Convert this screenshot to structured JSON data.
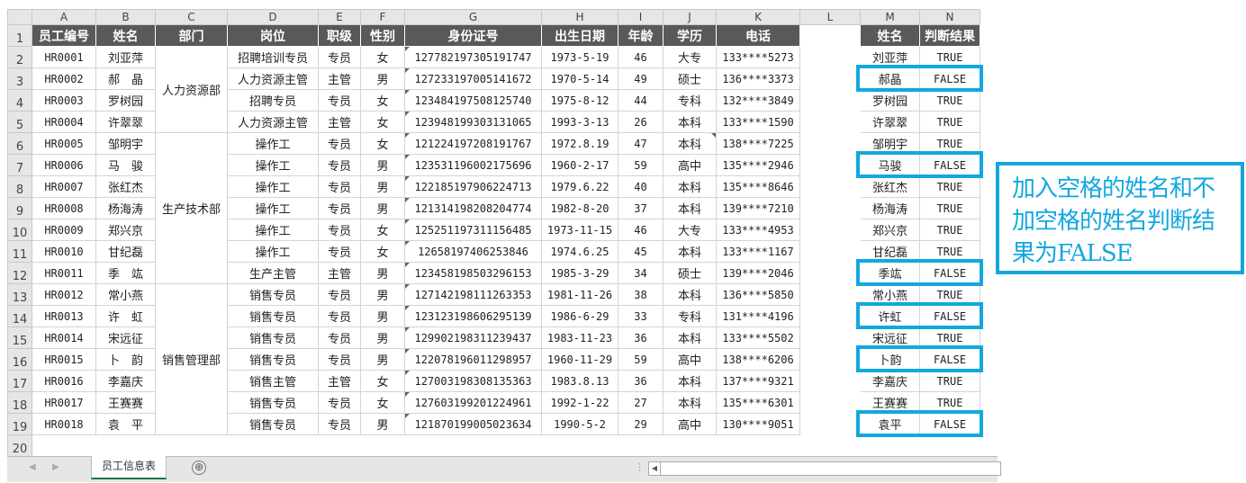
{
  "columns": [
    "A",
    "B",
    "C",
    "D",
    "E",
    "F",
    "G",
    "H",
    "I",
    "J",
    "K",
    "L",
    "M",
    "N"
  ],
  "headers": [
    "员工编号",
    "姓名",
    "部门",
    "岗位",
    "职级",
    "性别",
    "身份证号",
    "出生日期",
    "年龄",
    "学历",
    "电话"
  ],
  "rows": [
    {
      "id": "HR0001",
      "name": "刘亚萍",
      "pos": "招聘培训专员",
      "level": "专员",
      "sex": "女",
      "idno": "127782197305191747",
      "birth": "1973-5-19",
      "age": "46",
      "edu": "大专",
      "phone": "133****5273"
    },
    {
      "id": "HR0002",
      "name": "郝　晶",
      "pos": "人力资源主管",
      "level": "主管",
      "sex": "男",
      "idno": "127233197005141672",
      "birth": "1970-5-14",
      "age": "49",
      "edu": "硕士",
      "phone": "136****3373"
    },
    {
      "id": "HR0003",
      "name": "罗树园",
      "pos": "招聘专员",
      "level": "专员",
      "sex": "女",
      "idno": "123484197508125740",
      "birth": "1975-8-12",
      "age": "44",
      "edu": "专科",
      "phone": "132****3849"
    },
    {
      "id": "HR0004",
      "name": "许翠翠",
      "pos": "人力资源主管",
      "level": "主管",
      "sex": "女",
      "idno": "123948199303131065",
      "birth": "1993-3-13",
      "age": "26",
      "edu": "本科",
      "phone": "133****1590"
    },
    {
      "id": "HR0005",
      "name": "邹明宇",
      "pos": "操作工",
      "level": "专员",
      "sex": "女",
      "idno": "121224197208191767",
      "birth": "1972.8.19",
      "age": "47",
      "edu": "本科",
      "phone": "138****7225"
    },
    {
      "id": "HR0006",
      "name": "马　骏",
      "pos": "操作工",
      "level": "专员",
      "sex": "男",
      "idno": "123531196002175696",
      "birth": "1960-2-17",
      "age": "59",
      "edu": "高中",
      "phone": "135****2946"
    },
    {
      "id": "HR0007",
      "name": "张红杰",
      "pos": "操作工",
      "level": "专员",
      "sex": "男",
      "idno": "122185197906224713",
      "birth": "1979.6.22",
      "age": "40",
      "edu": "本科",
      "phone": "135****8646"
    },
    {
      "id": "HR0008",
      "name": "杨海涛",
      "pos": "操作工",
      "level": "专员",
      "sex": "男",
      "idno": "121314198208204774",
      "birth": "1982-8-20",
      "age": "37",
      "edu": "本科",
      "phone": "139****7210"
    },
    {
      "id": "HR0009",
      "name": "郑兴京",
      "pos": "操作工",
      "level": "专员",
      "sex": "女",
      "idno": "125251197311156485",
      "birth": "1973-11-15",
      "age": "46",
      "edu": "大专",
      "phone": "133****4953"
    },
    {
      "id": "HR0010",
      "name": "甘纪磊",
      "pos": "操作工",
      "level": "专员",
      "sex": "女",
      "idno": "12658197406253846",
      "birth": "1974.6.25",
      "age": "45",
      "edu": "本科",
      "phone": "133****1167"
    },
    {
      "id": "HR0011",
      "name": "季　竑",
      "pos": "生产主管",
      "level": "主管",
      "sex": "男",
      "idno": "123458198503296153",
      "birth": "1985-3-29",
      "age": "34",
      "edu": "硕士",
      "phone": "139****2046"
    },
    {
      "id": "HR0012",
      "name": "常小燕",
      "pos": "销售专员",
      "level": "专员",
      "sex": "男",
      "idno": "127142198111263353",
      "birth": "1981-11-26",
      "age": "38",
      "edu": "本科",
      "phone": "136****5850"
    },
    {
      "id": "HR0013",
      "name": "许　虹",
      "pos": "销售专员",
      "level": "专员",
      "sex": "男",
      "idno": "123123198606295139",
      "birth": "1986-6-29",
      "age": "33",
      "edu": "专科",
      "phone": "131****4196"
    },
    {
      "id": "HR0014",
      "name": "宋远征",
      "pos": "销售专员",
      "level": "专员",
      "sex": "男",
      "idno": "129902198311239437",
      "birth": "1983-11-23",
      "age": "36",
      "edu": "本科",
      "phone": "133****5502"
    },
    {
      "id": "HR0015",
      "name": "卜　韵",
      "pos": "销售专员",
      "level": "专员",
      "sex": "男",
      "idno": "122078196011298957",
      "birth": "1960-11-29",
      "age": "59",
      "edu": "高中",
      "phone": "138****6206"
    },
    {
      "id": "HR0016",
      "name": "李嘉庆",
      "pos": "销售主管",
      "level": "主管",
      "sex": "女",
      "idno": "127003198308135363",
      "birth": "1983.8.13",
      "age": "36",
      "edu": "本科",
      "phone": "137****9321"
    },
    {
      "id": "HR0017",
      "name": "王赛赛",
      "pos": "销售专员",
      "level": "专员",
      "sex": "女",
      "idno": "127603199201224961",
      "birth": "1992-1-22",
      "age": "27",
      "edu": "本科",
      "phone": "135****6301"
    },
    {
      "id": "HR0018",
      "name": "袁　平",
      "pos": "销售专员",
      "level": "专员",
      "sex": "男",
      "idno": "121870199005023634",
      "birth": "1990-5-2",
      "age": "29",
      "edu": "高中",
      "phone": "130****9051"
    }
  ],
  "departments": [
    {
      "name": "人力资源部",
      "start": 0,
      "span": 4
    },
    {
      "name": "生产技术部",
      "start": 4,
      "span": 7
    },
    {
      "name": "销售管理部",
      "start": 11,
      "span": 7
    }
  ],
  "lookup": {
    "headers": [
      "姓名",
      "判断结果"
    ],
    "rows": [
      {
        "name": "刘亚萍",
        "result": "TRUE"
      },
      {
        "name": "郝晶",
        "result": "FALSE"
      },
      {
        "name": "罗树园",
        "result": "TRUE"
      },
      {
        "name": "许翠翠",
        "result": "TRUE"
      },
      {
        "name": "邹明宇",
        "result": "TRUE"
      },
      {
        "name": "马骏",
        "result": "FALSE"
      },
      {
        "name": "张红杰",
        "result": "TRUE"
      },
      {
        "name": "杨海涛",
        "result": "TRUE"
      },
      {
        "name": "郑兴京",
        "result": "TRUE"
      },
      {
        "name": "甘纪磊",
        "result": "TRUE"
      },
      {
        "name": "季竑",
        "result": "FALSE"
      },
      {
        "name": "常小燕",
        "result": "TRUE"
      },
      {
        "name": "许虹",
        "result": "FALSE"
      },
      {
        "name": "宋远征",
        "result": "TRUE"
      },
      {
        "name": "卜韵",
        "result": "FALSE"
      },
      {
        "name": "李嘉庆",
        "result": "TRUE"
      },
      {
        "name": "王赛赛",
        "result": "TRUE"
      },
      {
        "name": "袁平",
        "result": "FALSE"
      }
    ]
  },
  "sheet_tab": "员工信息表",
  "add_sheet": "⊕",
  "callout": "加入空格的姓名和不加空格的姓名判断结果为FALSE",
  "colors": {
    "header_bg": "#595959",
    "highlight": "#12a7e0"
  }
}
